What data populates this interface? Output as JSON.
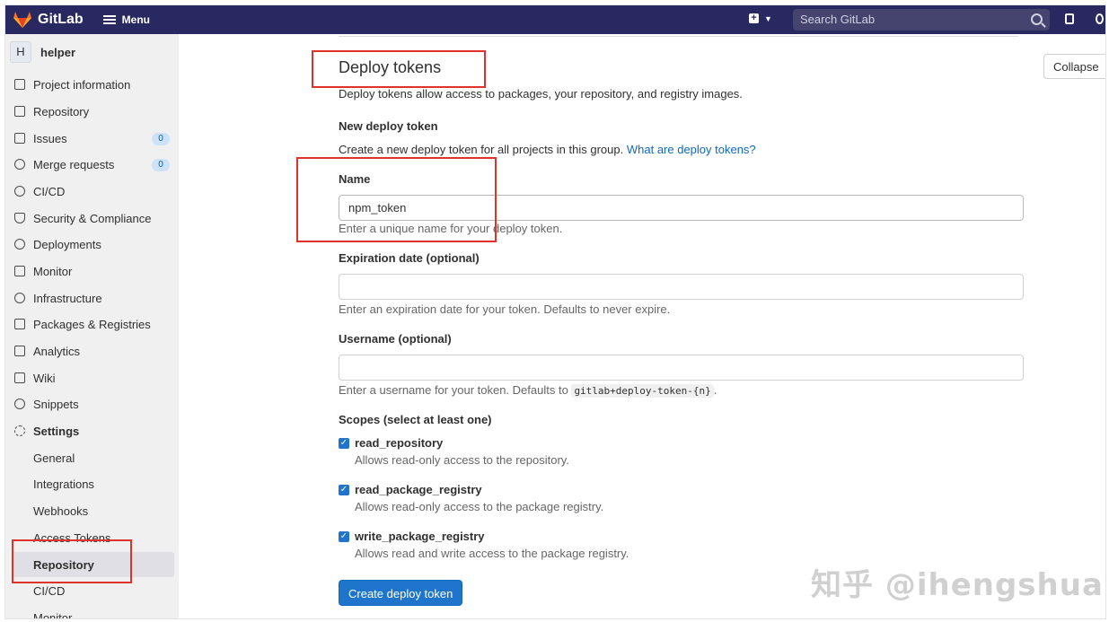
{
  "header": {
    "app_name": "GitLab",
    "menu_label": "Menu",
    "new_icon": "plus-square-icon",
    "search_placeholder": "Search GitLab"
  },
  "sidebar": {
    "project_avatar": "H",
    "project_name": "helper",
    "items": [
      {
        "label": "Project information",
        "icon": "info-icon"
      },
      {
        "label": "Repository",
        "icon": "document-icon"
      },
      {
        "label": "Issues",
        "icon": "issues-icon",
        "count": "0"
      },
      {
        "label": "Merge requests",
        "icon": "merge-request-icon",
        "count": "0"
      },
      {
        "label": "CI/CD",
        "icon": "rocket-icon"
      },
      {
        "label": "Security & Compliance",
        "icon": "shield-icon"
      },
      {
        "label": "Deployments",
        "icon": "deployments-icon"
      },
      {
        "label": "Monitor",
        "icon": "monitor-icon"
      },
      {
        "label": "Infrastructure",
        "icon": "infrastructure-icon"
      },
      {
        "label": "Packages & Registries",
        "icon": "package-icon"
      },
      {
        "label": "Analytics",
        "icon": "chart-icon"
      },
      {
        "label": "Wiki",
        "icon": "book-icon"
      },
      {
        "label": "Snippets",
        "icon": "scissors-icon"
      },
      {
        "label": "Settings",
        "icon": "gear-icon"
      }
    ],
    "settings_sub": [
      "General",
      "Integrations",
      "Webhooks",
      "Access Tokens",
      "Repository",
      "CI/CD",
      "Monitor"
    ],
    "active_sub": "Repository"
  },
  "main": {
    "section_title": "Deploy tokens",
    "collapse_label": "Collapse",
    "section_description": "Deploy tokens allow access to packages, your repository, and registry images.",
    "new_token_heading": "New deploy token",
    "new_token_description": "Create a new deploy token for all projects in this group.",
    "help_link": "What are deploy tokens?",
    "name_label": "Name",
    "name_value": "npm_token",
    "name_help": "Enter a unique name for your deploy token.",
    "expiration_label": "Expiration date (optional)",
    "expiration_help": "Enter an expiration date for your token. Defaults to never expire.",
    "username_label": "Username (optional)",
    "username_help_prefix": "Enter a username for your token. Defaults to",
    "username_help_code": "gitlab+deploy-token-{n}",
    "username_help_suffix": ".",
    "scopes_label": "Scopes (select at least one)",
    "scopes": [
      {
        "name": "read_repository",
        "description": "Allows read-only access to the repository.",
        "checked": true
      },
      {
        "name": "read_package_registry",
        "description": "Allows read-only access to the package registry.",
        "checked": true
      },
      {
        "name": "write_package_registry",
        "description": "Allows read and write access to the package registry.",
        "checked": true
      }
    ],
    "submit_label": "Create deploy token"
  },
  "annotation_color": "#e0312a",
  "accent_color": "#1f75cb",
  "watermark": "知乎 @ihengshuai"
}
